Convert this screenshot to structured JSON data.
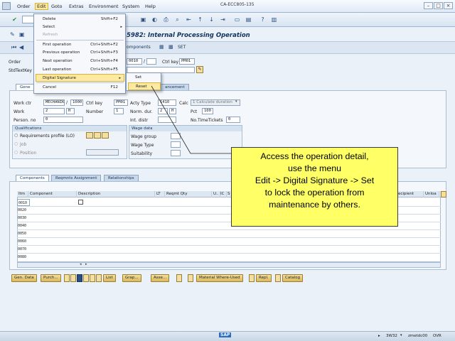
{
  "window": {
    "title": "CA-ECC805-135",
    "menu": [
      "Order",
      "Edit",
      "Goto",
      "Extras",
      "Environment",
      "System",
      "Help"
    ]
  },
  "header": {
    "title": "5982: Internal Processing Operation",
    "components_label": "omponents",
    "set_label": "SET",
    "order_label": "Order",
    "stdtextkey_label": "StdTextKey",
    "operation_value": "0010",
    "ctrl_key_label": "Ctrl key",
    "ctrl_key_value": "PM01"
  },
  "edit_menu": {
    "items": [
      {
        "label": "Delete",
        "shortcut": "Shift+F2"
      },
      {
        "label": "Select",
        "shortcut": ""
      },
      {
        "label": "Refresh",
        "shortcut": ""
      },
      {
        "label": "First operation",
        "shortcut": "Ctrl+Shift+F2"
      },
      {
        "label": "Previous operation",
        "shortcut": "Ctrl+Shift+F3"
      },
      {
        "label": "Next operation",
        "shortcut": "Ctrl+Shift+F4"
      },
      {
        "label": "Last operation",
        "shortcut": "Ctrl+Shift+F5"
      },
      {
        "label": "Digital Signature",
        "shortcut": ""
      },
      {
        "label": "Cancel",
        "shortcut": "F12"
      }
    ],
    "submenu": [
      "Set",
      "Reset"
    ]
  },
  "tabs_top": [
    "Gene",
    "ancement"
  ],
  "general": {
    "work_ctr_label": "Work ctr",
    "work_ctr_value": "MECHANIK",
    "plant_value": "1000",
    "ctrl_key_label": "Ctrl key",
    "ctrl_key_value": "PM01",
    "acty_type_label": "Acty Type",
    "acty_type_value": "1410",
    "calc_label": "Calc",
    "calc_value": "1 Calculate duration",
    "work_label": "Work",
    "work_value": "2",
    "work_unit": "H",
    "number_label": "Number",
    "number_value": "1",
    "norm_dur_label": "Norm. dur.",
    "norm_dur_value": "2",
    "norm_dur_unit": "H",
    "pct_label": "Pct",
    "pct_value": "100",
    "person_no_label": "Person. no",
    "person_no_value": "0",
    "int_distr_label": "Int. distr",
    "no_time_tickets_label": "No.TimeTickets",
    "no_time_tickets_value": "0",
    "qualifications_label": "Qualifications",
    "requirements_profile_label": "Requirements profile (LO)",
    "job_label": "Job",
    "position_label": "Position",
    "wage_data_label": "Wage data",
    "wage_group_label": "Wage group",
    "wage_type_label": "Wage Type",
    "suitability_label": "Suitability"
  },
  "tabs_bottom": [
    "Components",
    "Reqmnts Assignment",
    "Relationships"
  ],
  "components_table": {
    "columns": [
      "Itm",
      "Component",
      "Description",
      "LT",
      "Reqmt Qty",
      "U..",
      "IC",
      "S",
      "ecipient",
      "Unloa"
    ],
    "rows": [
      "0010",
      "0020",
      "0030",
      "0040",
      "0050",
      "0060",
      "0070",
      "0080"
    ]
  },
  "bottom_buttons": [
    "Gen. Data",
    "Purch...",
    "List",
    "Grap...",
    "Asse...",
    "Material Where-Used",
    "Repl.",
    "Catalog"
  ],
  "status_bar": {
    "logo": "SAP",
    "session": "3W32",
    "server": "zmetdc00",
    "mode": "OVR"
  },
  "callout": {
    "lines": [
      "Access the operation detail,",
      "use the menu",
      "Edit -> Digital Signature -> Set",
      "to lock the operation from",
      "maintenance by others."
    ]
  },
  "colors": {
    "callout_bg": "#ffff66",
    "menu_highlight": "#fde9a0",
    "button_gold": "#dbb85a"
  }
}
